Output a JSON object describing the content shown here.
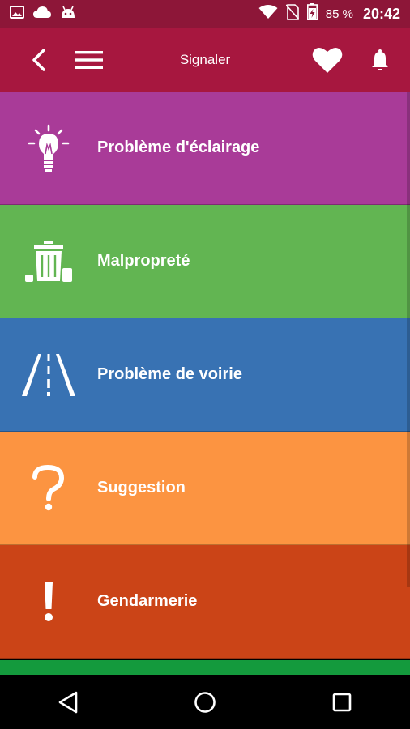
{
  "status_bar": {
    "icons": [
      "image-icon",
      "cloud-icon",
      "android-icon",
      "wifi-icon",
      "no-sim-icon",
      "battery-charging-icon"
    ],
    "battery_percent": "85 %",
    "time": "20:42"
  },
  "app_bar": {
    "title": "Signaler",
    "icons": [
      "back-arrow-icon",
      "menu-icon",
      "heart-icon",
      "bell-icon"
    ]
  },
  "categories": [
    {
      "label": "Problème d'éclairage",
      "icon": "lightbulb-icon",
      "color": "#a93b98"
    },
    {
      "label": "Malpropreté",
      "icon": "trash-can-icon",
      "color": "#62b552"
    },
    {
      "label": "Problème de voirie",
      "icon": "road-icon",
      "color": "#3872b3"
    },
    {
      "label": "Suggestion",
      "icon": "question-mark-icon",
      "color": "#fc9441"
    },
    {
      "label": "Gendarmerie",
      "icon": "exclamation-icon",
      "color": "#cb4417"
    }
  ],
  "partial_row_color": "#149a3d",
  "nav_bar": {
    "icons": [
      "back-triangle-icon",
      "home-circle-icon",
      "recents-square-icon"
    ]
  },
  "colors": {
    "status_bar": "#8d1638",
    "app_bar": "#a7173f"
  }
}
